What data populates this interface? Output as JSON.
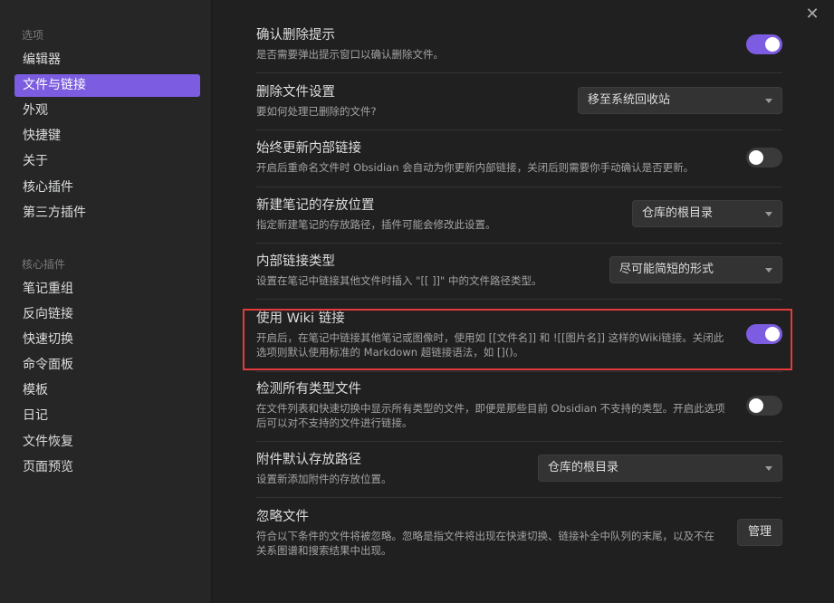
{
  "window": {
    "close_glyph": "✕"
  },
  "sidebar": {
    "options_title": "选项",
    "options": [
      {
        "label": "编辑器",
        "active": false
      },
      {
        "label": "文件与链接",
        "active": true
      },
      {
        "label": "外观",
        "active": false
      },
      {
        "label": "快捷键",
        "active": false
      },
      {
        "label": "关于",
        "active": false
      },
      {
        "label": "核心插件",
        "active": false
      },
      {
        "label": "第三方插件",
        "active": false
      }
    ],
    "plugins_title": "核心插件",
    "plugins": [
      {
        "label": "笔记重组"
      },
      {
        "label": "反向链接"
      },
      {
        "label": "快速切换"
      },
      {
        "label": "命令面板"
      },
      {
        "label": "模板"
      },
      {
        "label": "日记"
      },
      {
        "label": "文件恢复"
      },
      {
        "label": "页面预览"
      }
    ]
  },
  "settings": [
    {
      "name": "确认删除提示",
      "desc": "是否需要弹出提示窗口以确认删除文件。",
      "control": "toggle",
      "state": "on"
    },
    {
      "name": "删除文件设置",
      "desc": "要如何处理已删除的文件?",
      "control": "dropdown",
      "value": "移至系统回收站"
    },
    {
      "name": "始终更新内部链接",
      "desc": "开启后重命名文件时 Obsidian 会自动为你更新内部链接，关闭后则需要你手动确认是否更新。",
      "control": "toggle",
      "state": "off"
    },
    {
      "name": "新建笔记的存放位置",
      "desc": "指定新建笔记的存放路径，插件可能会修改此设置。",
      "control": "dropdown",
      "value": "仓库的根目录"
    },
    {
      "name": "内部链接类型",
      "desc": "设置在笔记中链接其他文件时插入 \"[[ ]]\" 中的文件路径类型。",
      "control": "dropdown",
      "value": "尽可能简短的形式"
    },
    {
      "name": "使用 Wiki 链接",
      "desc": "开启后，在笔记中链接其他笔记或图像时，使用如 [[文件名]] 和 ![[图片名]] 这样的Wiki链接。关闭此选项则默认使用标准的 Markdown 超链接语法，如 []()。",
      "control": "toggle",
      "state": "on"
    },
    {
      "name": "检测所有类型文件",
      "desc": "在文件列表和快速切换中显示所有类型的文件，即便是那些目前 Obsidian 不支持的类型。开启此选项后可以对不支持的文件进行链接。",
      "control": "toggle",
      "state": "off"
    },
    {
      "name": "附件默认存放路径",
      "desc": "设置新添加附件的存放位置。",
      "control": "dropdown",
      "value": "仓库的根目录"
    },
    {
      "name": "忽略文件",
      "desc": "符合以下条件的文件将被忽略。忽略是指文件将出现在快速切换、链接补全中队列的末尾，以及不在关系图谱和搜索结果中出现。",
      "control": "button",
      "value": "管理"
    }
  ],
  "colors": {
    "accent": "#7c5ce0",
    "highlight": "#e23b3b"
  }
}
